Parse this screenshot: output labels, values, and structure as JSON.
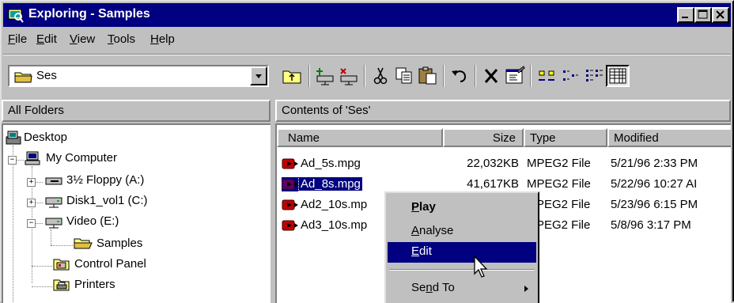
{
  "window": {
    "title": "Exploring - Samples"
  },
  "menu": [
    {
      "key": "F",
      "rest": "ile"
    },
    {
      "key": "E",
      "rest": "dit"
    },
    {
      "key": "V",
      "rest": "iew"
    },
    {
      "key": "T",
      "rest": "ools"
    },
    {
      "key": "H",
      "rest": "elp"
    }
  ],
  "address_combo": {
    "value": "Ses"
  },
  "panes": {
    "all_folders": "All Folders",
    "contents": "Contents of 'Ses'"
  },
  "tree": {
    "desktop": "Desktop",
    "my_computer": "My Computer",
    "floppy": "3½ Floppy (A:)",
    "disk1": "Disk1_vol1 (C:)",
    "video": "Video (E:)",
    "samples": "Samples",
    "control_panel": "Control Panel",
    "printers": "Printers"
  },
  "columns": {
    "name": "Name",
    "size": "Size",
    "type": "Type",
    "modified": "Modified"
  },
  "files": [
    {
      "name": "Ad_5s.mpg",
      "size": "22,032KB",
      "type": "MPEG2 File",
      "modified": "5/21/96 2:33 PM"
    },
    {
      "name": "Ad_8s.mpg",
      "size": "41,617KB",
      "type": "MPEG2 File",
      "modified": "5/22/96 10:27 AI"
    },
    {
      "name": "Ad2_10s.mp",
      "size": "",
      "type": "PEG2 File",
      "modified": "5/23/96 6:15 PM"
    },
    {
      "name": "Ad3_10s.mp",
      "size": "",
      "type": "PEG2 File",
      "modified": "5/8/96 3:17 PM"
    }
  ],
  "context_menu": {
    "play": {
      "key": "P",
      "rest": "lay"
    },
    "analyse": {
      "key": "A",
      "rest": "nalyse"
    },
    "edit": {
      "key": "E",
      "rest": "dit"
    },
    "send_to": {
      "pre": "Se",
      "key": "n",
      "rest": "d To"
    }
  },
  "colors": {
    "titlebar": "#000080",
    "face": "#c0c0c0",
    "selection": "#000080",
    "file_icon": "#c00000"
  }
}
